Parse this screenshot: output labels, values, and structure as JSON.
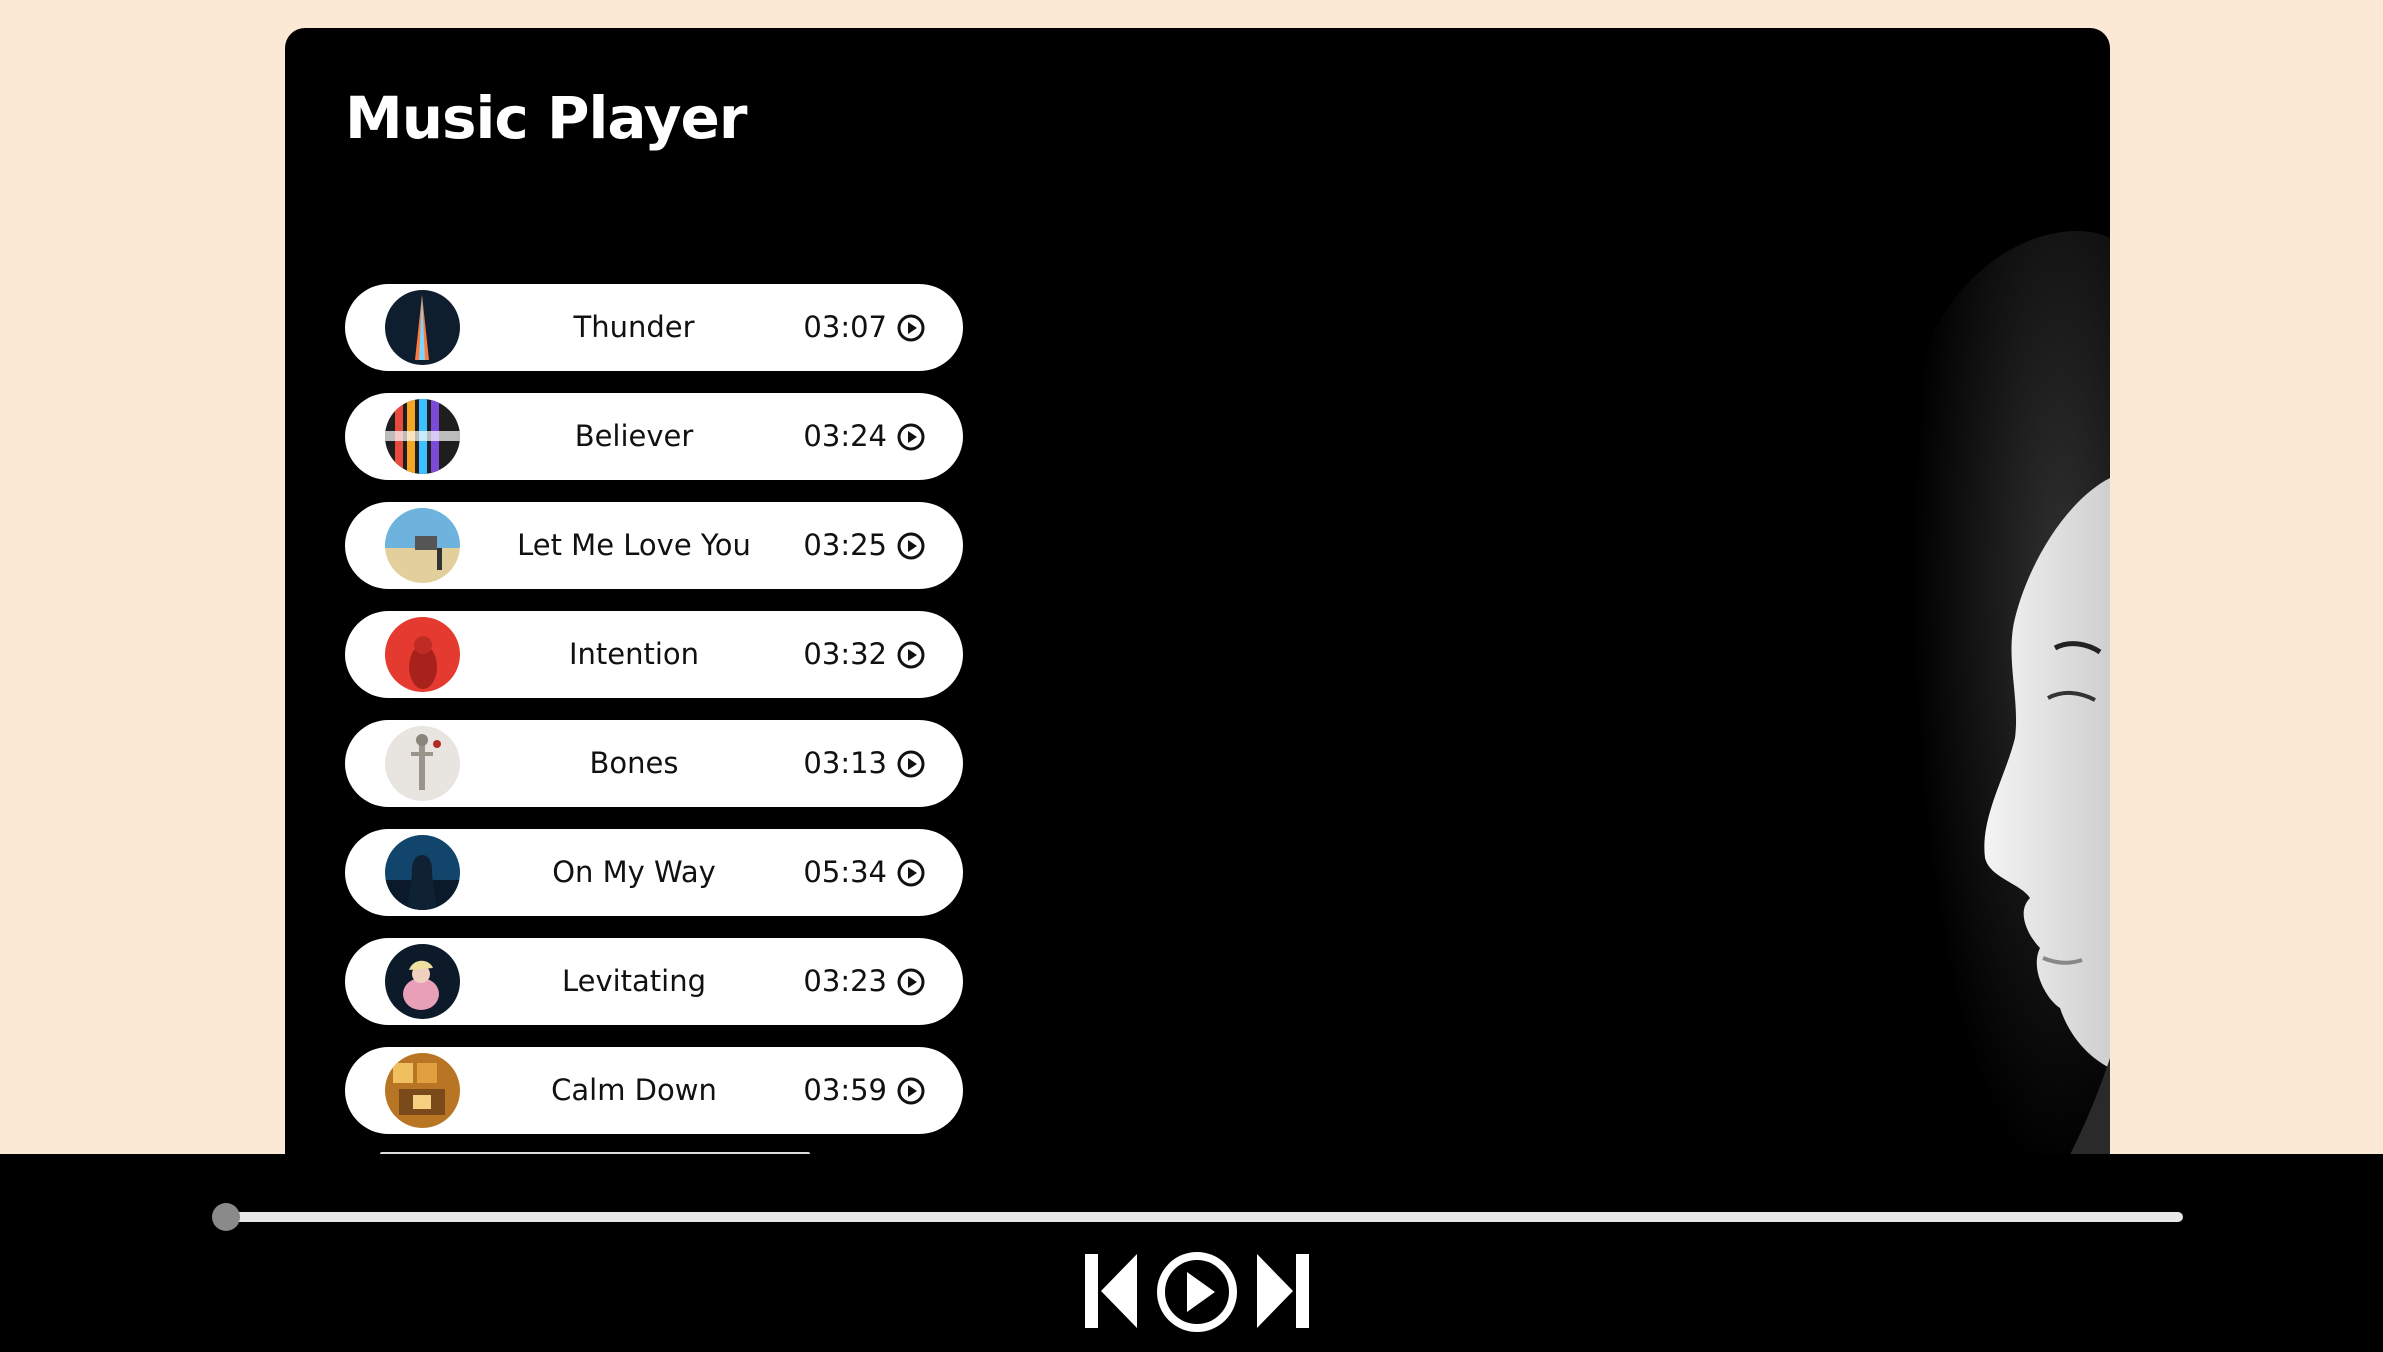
{
  "app": {
    "title": "Music Player"
  },
  "songs": [
    {
      "name": "Thunder",
      "duration": "03:07",
      "cover_colors": [
        "#1a2a3a",
        "#ff6a3d",
        "#5ad0ff"
      ]
    },
    {
      "name": "Believer",
      "duration": "03:24",
      "cover_colors": [
        "#222",
        "#e84b3c",
        "#3dc0ff"
      ]
    },
    {
      "name": "Let Me Love You",
      "duration": "03:25",
      "cover_colors": [
        "#6db3dd",
        "#e9d7a6",
        "#c9ad7a"
      ]
    },
    {
      "name": "Intention",
      "duration": "03:32",
      "cover_colors": [
        "#e53a2f",
        "#c82a22",
        "#7a1b16"
      ]
    },
    {
      "name": "Bones",
      "duration": "03:13",
      "cover_colors": [
        "#e8e5e0",
        "#cfcac2",
        "#b02a2a"
      ]
    },
    {
      "name": "On My Way",
      "duration": "05:34",
      "cover_colors": [
        "#0e3a5a",
        "#2e7fb8",
        "#0a1a2a"
      ]
    },
    {
      "name": "Levitating",
      "duration": "03:23",
      "cover_colors": [
        "#0c1a2a",
        "#e8a0b8",
        "#f5d2dc"
      ]
    },
    {
      "name": "Calm Down",
      "duration": "03:59",
      "cover_colors": [
        "#c8862a",
        "#f0c060",
        "#7a4a1a"
      ]
    }
  ],
  "player": {
    "progress": 0
  },
  "icons": [
    "play-circle-icon",
    "skip-back-icon",
    "play-icon",
    "skip-forward-icon"
  ],
  "colors": {
    "page_background": "#fbe9d5",
    "panel_background": "#000000",
    "row_background": "#ffffff"
  }
}
